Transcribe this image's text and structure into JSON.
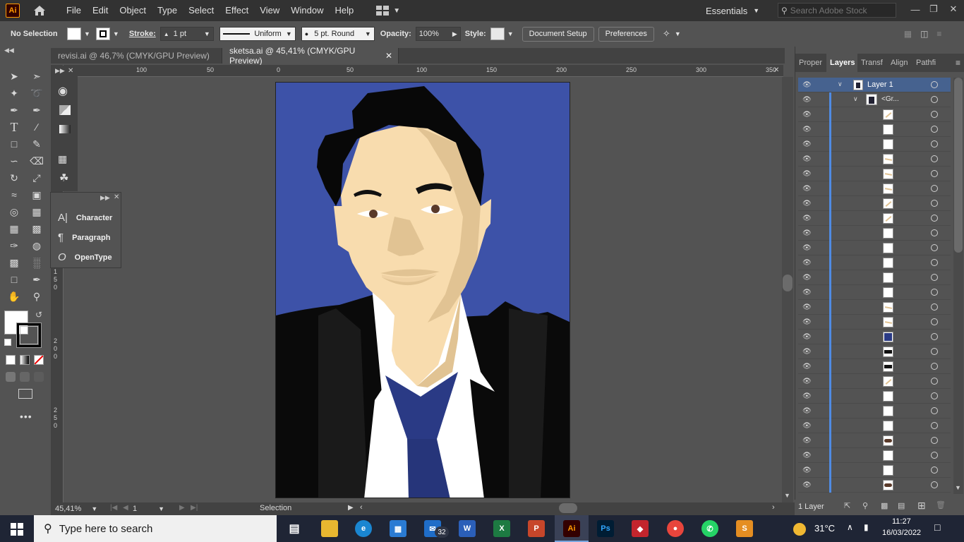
{
  "menubar": {
    "app_logo": "Ai",
    "items": [
      "File",
      "Edit",
      "Object",
      "Type",
      "Select",
      "Effect",
      "View",
      "Window",
      "Help"
    ],
    "workspace": "Essentials",
    "search_placeholder": "Search Adobe Stock"
  },
  "control": {
    "selection_state": "No Selection",
    "stroke_label": "Stroke:",
    "stroke_weight": "1 pt",
    "stroke_profile": "Uniform",
    "brush": "5 pt. Round",
    "opacity_label": "Opacity:",
    "opacity": "100%",
    "style_label": "Style:",
    "document_setup": "Document Setup",
    "preferences": "Preferences"
  },
  "tabs": [
    {
      "label": "revisi.ai @ 46,7% (CMYK/GPU Preview)",
      "active": false
    },
    {
      "label": "sketsa.ai @ 45,41% (CMYK/GPU Preview)",
      "active": true
    }
  ],
  "ruler_h": [
    "100",
    "50",
    "0",
    "50",
    "100",
    "150",
    "200",
    "250",
    "300",
    "350"
  ],
  "ruler_v": [
    "1\n5\n0",
    "2\n0\n0",
    "2\n5\n0"
  ],
  "type_panel": {
    "items": [
      {
        "label": "Character",
        "icon": "character-icon"
      },
      {
        "label": "Paragraph",
        "icon": "paragraph-icon"
      },
      {
        "label": "OpenType",
        "icon": "opentype-icon"
      }
    ]
  },
  "right_panel": {
    "tabs": [
      "Proper",
      "Layers",
      "Transf",
      "Align",
      "Pathfi"
    ],
    "active_tab": "Layers",
    "layer_name": "Layer 1",
    "group_name": "<Gr...",
    "footer_count": "1 Layer"
  },
  "status": {
    "zoom": "45,41%",
    "artboard_num": "1",
    "tool": "Selection"
  },
  "taskbar": {
    "search_placeholder": "Type here to search",
    "mail_badge": "32",
    "temperature": "31°C",
    "time": "11:27",
    "date": "16/03/2022"
  },
  "colors": {
    "artboard_bg": "#3d52a8",
    "skin": "#f8dcae",
    "skin_shadow": "#e1c393",
    "hair": "#080808",
    "tie": "#2a3a85",
    "layer_bar": "#4f8be3"
  }
}
